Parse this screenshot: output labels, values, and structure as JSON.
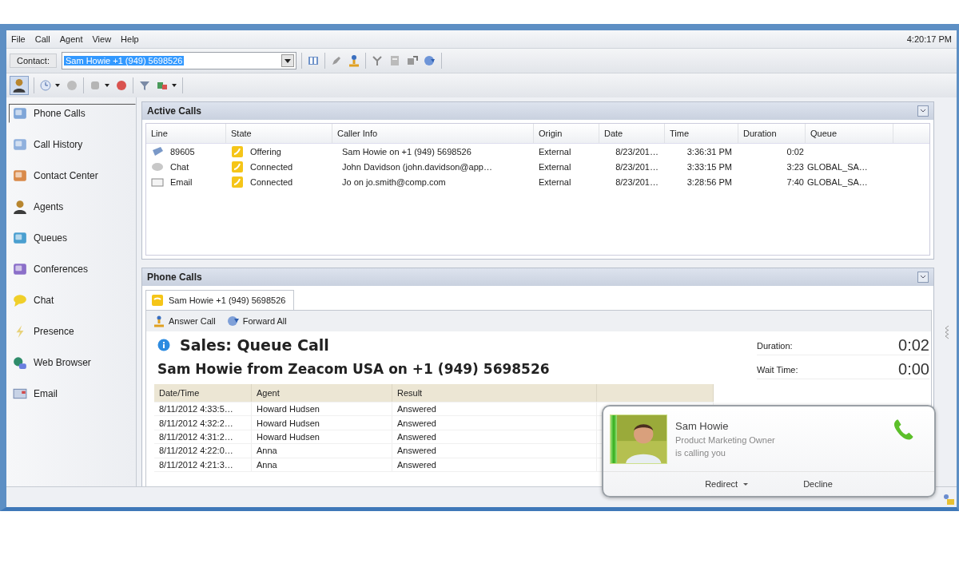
{
  "window": {
    "clock": "4:20:17 PM"
  },
  "menu": [
    {
      "label": "File"
    },
    {
      "label": "Call"
    },
    {
      "label": "Agent"
    },
    {
      "label": "View"
    },
    {
      "label": "Help"
    }
  ],
  "contact_bar": {
    "label": "Contact:",
    "value": "Sam Howie +1 (949) 5698526",
    "text_selected": true
  },
  "sidebar": {
    "items": [
      {
        "label": "Phone Calls",
        "kind": "phone",
        "selected": true
      },
      {
        "label": "Call History",
        "kind": "history",
        "selected": false
      },
      {
        "label": "Contact Center",
        "kind": "center",
        "selected": false
      },
      {
        "label": "Agents",
        "kind": "agent",
        "selected": false
      },
      {
        "label": "Queues",
        "kind": "queue",
        "selected": false
      },
      {
        "label": "Conferences",
        "kind": "conference",
        "selected": false
      },
      {
        "label": "Chat",
        "kind": "chat",
        "selected": false
      },
      {
        "label": "Presence",
        "kind": "presence",
        "selected": false
      },
      {
        "label": "Web Browser",
        "kind": "web",
        "selected": false
      },
      {
        "label": "Email",
        "kind": "email",
        "selected": false
      }
    ]
  },
  "active_calls": {
    "title": "Active Calls",
    "columns": [
      "Line",
      "State",
      "Caller Info",
      "Origin",
      "Date",
      "Time",
      "Duration",
      "Queue"
    ],
    "rows": [
      {
        "kind": "phone",
        "line": "89605",
        "state": "Offering",
        "caller_info": "Sam Howie on +1 (949) 5698526",
        "origin": "External",
        "date": "8/23/201…",
        "time": "3:36:31 PM",
        "duration": "0:02"
      },
      {
        "kind": "chat",
        "line": "Chat",
        "state": "Connected",
        "caller_info": "John Davidson (john.davidson@app…",
        "origin": "External",
        "date": "8/23/201…",
        "time": "3:33:15 PM",
        "duration": "3:23",
        "queue": "GLOBAL_SA…"
      },
      {
        "kind": "email",
        "line": "Email",
        "state": "Connected",
        "caller_info": "Jo on jo.smith@comp.com",
        "origin": "External",
        "date": "8/23/201…",
        "time": "3:28:56 PM",
        "duration": "7:40",
        "queue": "GLOBAL_SA…"
      }
    ]
  },
  "phone_calls": {
    "title": "Phone Calls",
    "tabs": [
      {
        "label": "Sam Howie +1 (949) 5698526",
        "selected": true
      }
    ],
    "actions": [
      {
        "label": "Answer Call",
        "kind": "answer"
      },
      {
        "label": "Forward All",
        "kind": "forward"
      }
    ],
    "heading": "Sales: Queue Call",
    "subheading": "Sam Howie from Zeacom USA on +1 (949) 5698526",
    "stats": [
      {
        "label": "Duration:",
        "value": "0:02"
      },
      {
        "label": "Wait Time:",
        "value": "0:00"
      }
    ],
    "history": {
      "columns": [
        "Date/Time",
        "Agent",
        "Result"
      ],
      "rows": [
        [
          "8/11/2012 4:33:5…",
          "Howard Hudsen",
          "Answered"
        ],
        [
          "8/11/2012 4:32:2…",
          "Howard Hudsen",
          "Answered"
        ],
        [
          "8/11/2012 4:31:2…",
          "Howard Hudsen",
          "Answered"
        ],
        [
          "8/11/2012 4:22:0…",
          "Anna",
          "Answered"
        ],
        [
          "8/11/2012 4:21:3…",
          "Anna",
          "Answered"
        ]
      ]
    }
  },
  "notification": {
    "name": "Sam Howie",
    "title": "Product Marketing Owner",
    "message": "is calling you",
    "actions": [
      {
        "label": "Redirect",
        "kind": "menu"
      },
      {
        "label": "Decline",
        "kind": "plain"
      }
    ]
  }
}
